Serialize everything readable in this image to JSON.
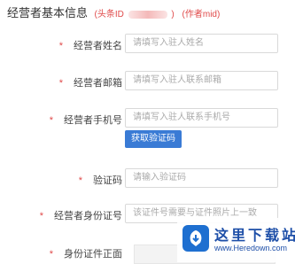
{
  "header": {
    "title": "经营者基本信息",
    "id_prefix": "(头条ID",
    "id_suffix": ")",
    "author_meta": "(作者mid)"
  },
  "form": {
    "required_mark": "*",
    "name": {
      "label": "经营者姓名",
      "placeholder": "请填写入驻人姓名"
    },
    "email": {
      "label": "经营者邮箱",
      "placeholder": "请填写入驻人联系邮箱"
    },
    "phone": {
      "label": "经营者手机号",
      "placeholder": "请填写入驻人联系手机号"
    },
    "get_code_button": "获取验证码",
    "code": {
      "label": "验证码",
      "placeholder": "请输入验证码"
    },
    "id_number": {
      "label": "经营者身份证号",
      "placeholder": "该证件号需要与证件照片上一致"
    },
    "id_front": {
      "label": "身份证件正面"
    }
  },
  "watermark": {
    "cn": "这里下载站",
    "en": "www.Heredown.com"
  }
}
